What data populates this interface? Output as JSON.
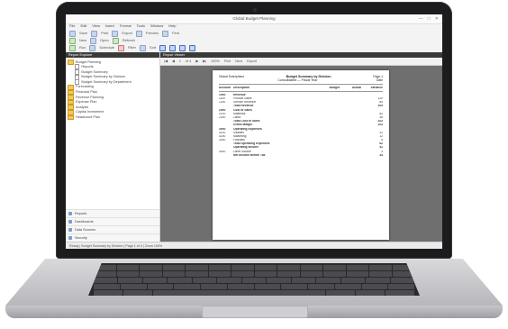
{
  "app": {
    "title": "Global Budget Planning",
    "window_controls": [
      "—",
      "□",
      "✕"
    ]
  },
  "menubar": [
    "File",
    "Edit",
    "View",
    "Insert",
    "Format",
    "Tools",
    "Window",
    "Help"
  ],
  "toolbar": {
    "row1": [
      "Save",
      "Print",
      "Export",
      "Preview",
      "Find"
    ],
    "row2": [
      "New",
      "Open",
      "Refresh"
    ],
    "row3": [
      "Run",
      "Schedule",
      "Filter",
      "Sort"
    ]
  },
  "left_pane": {
    "header": "Report Explorer",
    "tree": [
      {
        "label": "Budget Planning",
        "type": "folder",
        "indent": 0
      },
      {
        "label": "Reports",
        "type": "doc",
        "indent": 2
      },
      {
        "label": "Budget Summary",
        "type": "doc",
        "indent": 2
      },
      {
        "label": "Budget Summary by Division",
        "type": "doc",
        "indent": 2
      },
      {
        "label": "Budget Summary by Department",
        "type": "doc",
        "indent": 2
      },
      {
        "label": "Forecasting",
        "type": "folder",
        "indent": 0
      },
      {
        "label": "Financial Plan",
        "type": "folder",
        "indent": 0
      },
      {
        "label": "Revenue Planning",
        "type": "folder",
        "indent": 0
      },
      {
        "label": "Expense Plan",
        "type": "folder",
        "indent": 0
      },
      {
        "label": "Analysis",
        "type": "folder",
        "indent": 0
      },
      {
        "label": "Capital Investment",
        "type": "folder",
        "indent": 0
      },
      {
        "label": "Headcount Plan",
        "type": "folder",
        "indent": 0
      }
    ],
    "bottom_nav": [
      "Reports",
      "Dashboards",
      "Data Sources",
      "Security"
    ]
  },
  "right_pane": {
    "header": "Report Viewer",
    "viewer_toolbar": [
      "|◀",
      "◀",
      "1",
      "of 4",
      "▶",
      "▶|",
      "100%",
      "Find",
      "Next",
      "Export"
    ]
  },
  "report": {
    "company": "Global Enterprises",
    "title": "Budget Summary by Division",
    "subtitle": "Consolidated — Fiscal Year",
    "page_label": "Page 1",
    "date_label": "Date",
    "col_headers": [
      "Account",
      "Description",
      "Budget",
      "Actual",
      "Variance"
    ],
    "lines": [
      {
        "c1": "1000",
        "c2": "Revenue",
        "c3": ""
      },
      {
        "c1": "1100",
        "c2": "Product Sales",
        "c3": "120"
      },
      {
        "c1": "1200",
        "c2": "Service Revenue",
        "c3": "85"
      },
      {
        "c1": "",
        "c2": "Total Revenue",
        "c3": "205"
      },
      {
        "c1": "2000",
        "c2": "Cost of Sales",
        "c3": ""
      },
      {
        "c1": "2100",
        "c2": "Materials",
        "c3": "64"
      },
      {
        "c1": "2200",
        "c2": "Labor",
        "c3": "38"
      },
      {
        "c1": "",
        "c2": "Total Cost of Sales",
        "c3": "102"
      },
      {
        "c1": "",
        "c2": "Gross Margin",
        "c3": "103"
      },
      {
        "c1": "3000",
        "c2": "Operating Expenses",
        "c3": ""
      },
      {
        "c1": "3100",
        "c2": "Salaries",
        "c3": "41"
      },
      {
        "c1": "3200",
        "c2": "Marketing",
        "c3": "12"
      },
      {
        "c1": "3300",
        "c2": "Facilities",
        "c3": "9"
      },
      {
        "c1": "",
        "c2": "Total Operating Expenses",
        "c3": "62"
      },
      {
        "c1": "",
        "c2": "Operating Income",
        "c3": "41"
      },
      {
        "c1": "4000",
        "c2": "Other Income",
        "c3": "3"
      },
      {
        "c1": "",
        "c2": "Net Income Before Tax",
        "c3": "44"
      }
    ]
  },
  "statusbar": "Ready   |   Budget Summary by Division   |   Page 1 of 4   |   Zoom 100%"
}
